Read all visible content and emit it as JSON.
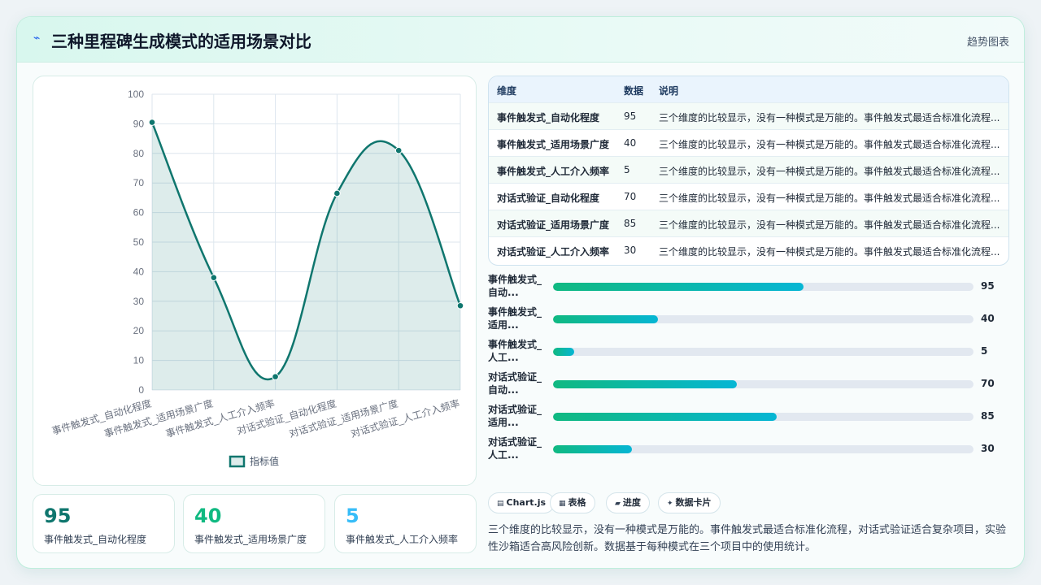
{
  "header": {
    "title": "三种里程碑生成模式的适用场景对比",
    "right_label": "趋势图表",
    "icon": "lightning-icon"
  },
  "chart_data": {
    "type": "line",
    "categories": [
      "事件触发式_自动化程度",
      "事件触发式_适用场景广度",
      "事件触发式_人工介入频率",
      "对话式验证_自动化程度",
      "对话式验证_适用场景广度",
      "对话式验证_人工介入频率"
    ],
    "series": [
      {
        "name": "指标值",
        "values": [
          90.5,
          38,
          4.5,
          66.5,
          81,
          28.5
        ]
      }
    ],
    "ylim": [
      0,
      100
    ],
    "yticks": [
      0,
      10,
      20,
      30,
      40,
      50,
      60,
      70,
      80,
      90,
      100
    ],
    "grid": true,
    "legend": "bottom",
    "color": "#0f766e"
  },
  "stats": [
    {
      "value": "95",
      "label": "事件触发式_自动化程度",
      "color": "#0f766e"
    },
    {
      "value": "40",
      "label": "事件触发式_适用场景广度",
      "color": "#10b981"
    },
    {
      "value": "5",
      "label": "事件触发式_人工介入频率",
      "color": "#38bdf8"
    }
  ],
  "table": {
    "headers": [
      "维度",
      "数据",
      "说明"
    ],
    "rows": [
      [
        "事件触发式_自动化程度",
        "95",
        "三个维度的比较显示，没有一种模式是万能的。事件触发式最适合标准化流程..."
      ],
      [
        "事件触发式_适用场景广度",
        "40",
        "三个维度的比较显示，没有一种模式是万能的。事件触发式最适合标准化流程..."
      ],
      [
        "事件触发式_人工介入频率",
        "5",
        "三个维度的比较显示，没有一种模式是万能的。事件触发式最适合标准化流程..."
      ],
      [
        "对话式验证_自动化程度",
        "70",
        "三个维度的比较显示，没有一种模式是万能的。事件触发式最适合标准化流程..."
      ],
      [
        "对话式验证_适用场景广度",
        "85",
        "三个维度的比较显示，没有一种模式是万能的。事件触发式最适合标准化流程..."
      ],
      [
        "对话式验证_人工介入频率",
        "30",
        "三个维度的比较显示，没有一种模式是万能的。事件触发式最适合标准化流程..."
      ]
    ]
  },
  "bars": [
    {
      "line1": "事件触发式_",
      "line2": "自动...",
      "value": 95,
      "display": "95",
      "fill_pct": 59.5
    },
    {
      "line1": "事件触发式_",
      "line2": "适用...",
      "value": 40,
      "display": "40",
      "fill_pct": 25
    },
    {
      "line1": "事件触发式_",
      "line2": "人工...",
      "value": 5,
      "display": "5",
      "fill_pct": 5
    },
    {
      "line1": "对话式验证_",
      "line2": "自动...",
      "value": 70,
      "display": "70",
      "fill_pct": 43.8
    },
    {
      "line1": "对话式验证_",
      "line2": "适用...",
      "value": 85,
      "display": "85",
      "fill_pct": 53.2
    },
    {
      "line1": "对话式验证_",
      "line2": "人工...",
      "value": 30,
      "display": "30",
      "fill_pct": 18.8
    }
  ],
  "chips": [
    {
      "icon": "table-icon",
      "glyph": "▤",
      "label": "Chart.js"
    },
    {
      "icon": "grid-icon",
      "glyph": "▦",
      "label": "表格"
    },
    {
      "icon": "progress-icon",
      "glyph": "▰",
      "label": "进度"
    },
    {
      "icon": "sparkle-icon",
      "glyph": "✦",
      "label": "数据卡片"
    }
  ],
  "description": "三个维度的比较显示，没有一种模式是万能的。事件触发式最适合标准化流程，对话式验证适合复杂项目，实验性沙箱适合高风险创新。数据基于每种模式在三个项目中的使用统计。"
}
